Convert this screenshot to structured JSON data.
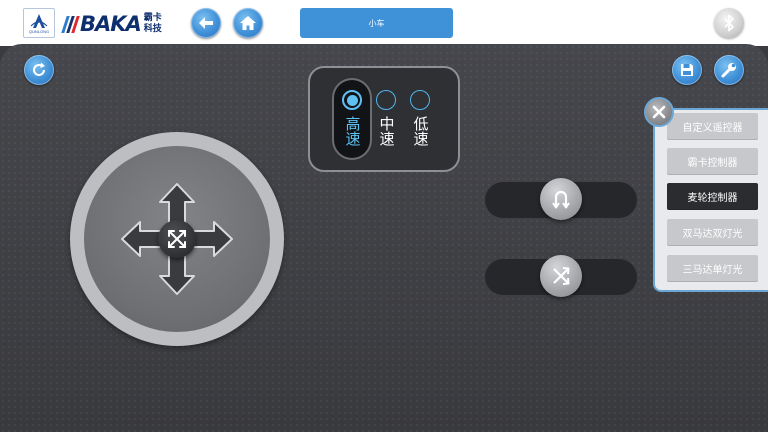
{
  "header": {
    "logo_sub": "QUNLONG",
    "brand_word": "BAKA",
    "brand_cn_top": "霸卡",
    "brand_cn_bottom": "科技",
    "title": "小车"
  },
  "icons": {
    "back": "arrow-left-icon",
    "home": "home-icon",
    "bluetooth": "bluetooth-icon",
    "refresh": "refresh-icon",
    "save": "floppy-icon",
    "settings": "wrench-icon",
    "close": "close-icon",
    "joystick": "move-arrows-icon",
    "u_turn": "u-turn-icon",
    "shuffle": "shuffle-icon"
  },
  "speed": {
    "options": [
      {
        "label": "高速",
        "selected": true
      },
      {
        "label": "中速",
        "selected": false
      },
      {
        "label": "低速",
        "selected": false
      }
    ]
  },
  "menu": {
    "items": [
      {
        "label": "自定义遥控器",
        "active": false
      },
      {
        "label": "霸卡控制器",
        "active": false
      },
      {
        "label": "麦轮控制器",
        "active": true
      },
      {
        "label": "双马达双灯光",
        "active": false
      },
      {
        "label": "三马达单灯光",
        "active": false
      }
    ]
  },
  "colors": {
    "accent": "#3f91d8",
    "selected_text": "#5cc2f4",
    "panel": "#3a3b3f",
    "brand_stripes": [
      "#2b7bd1",
      "#17336b",
      "#e0282d"
    ]
  }
}
